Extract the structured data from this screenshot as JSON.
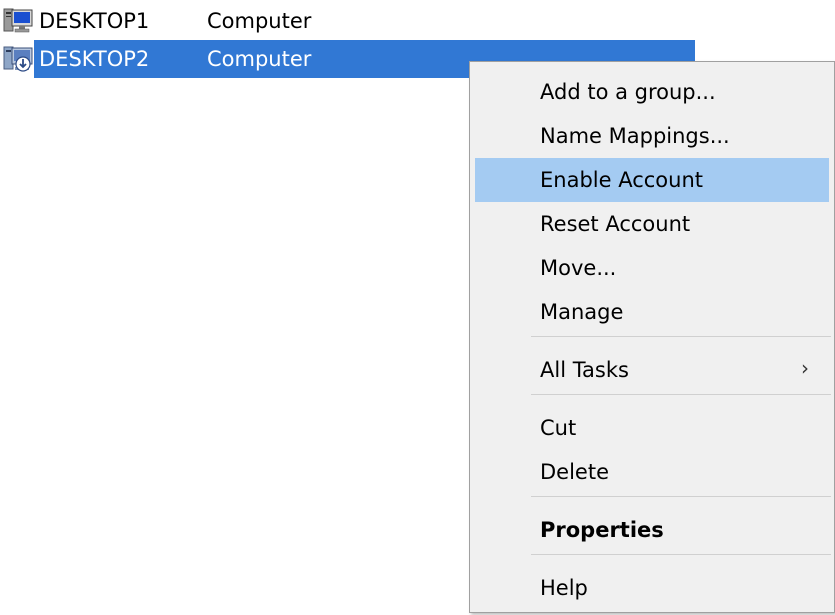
{
  "list": {
    "rows": [
      {
        "name": "DESKTOP1",
        "type": "Computer",
        "icon": "computer-icon",
        "selected": false
      },
      {
        "name": "DESKTOP2",
        "type": "Computer",
        "icon": "disabled-computer-icon",
        "selected": true
      }
    ]
  },
  "context_menu": {
    "items": [
      {
        "label": "Add to a group..."
      },
      {
        "label": "Name Mappings..."
      },
      {
        "label": "Enable Account"
      },
      {
        "label": "Reset Account"
      },
      {
        "label": "Move..."
      },
      {
        "label": "Manage"
      },
      {
        "label": "All Tasks",
        "submenu_arrow": "›"
      },
      {
        "label": "Cut"
      },
      {
        "label": "Delete"
      },
      {
        "label": "Properties"
      },
      {
        "label": "Help"
      }
    ]
  },
  "colors": {
    "selection": "#3178d4",
    "menu_hover": "#a4cbf2",
    "menu_background": "#f0f0f0"
  }
}
